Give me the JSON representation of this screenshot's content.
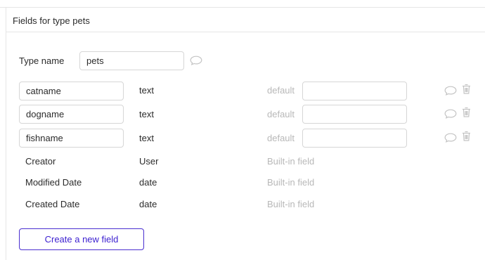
{
  "section": {
    "title": "Fields for type pets"
  },
  "type": {
    "label": "Type name",
    "value": "pets"
  },
  "fields": [
    {
      "name": "catname",
      "type": "text",
      "default_label": "default",
      "default_value": ""
    },
    {
      "name": "dogname",
      "type": "text",
      "default_label": "default",
      "default_value": ""
    },
    {
      "name": "fishname",
      "type": "text",
      "default_label": "default",
      "default_value": ""
    }
  ],
  "builtin": [
    {
      "name": "Creator",
      "type": "User",
      "note": "Built-in field"
    },
    {
      "name": "Modified Date",
      "type": "date",
      "note": "Built-in field"
    },
    {
      "name": "Created Date",
      "type": "date",
      "note": "Built-in field"
    }
  ],
  "actions": {
    "create_label": "Create a new field"
  },
  "icons": {
    "comment": "comment-icon",
    "delete": "trash-icon"
  },
  "colors": {
    "accent": "#4a2fd0",
    "muted": "#b8b8b8",
    "border": "#d6d6d6",
    "icon": "#c4c4c4"
  }
}
